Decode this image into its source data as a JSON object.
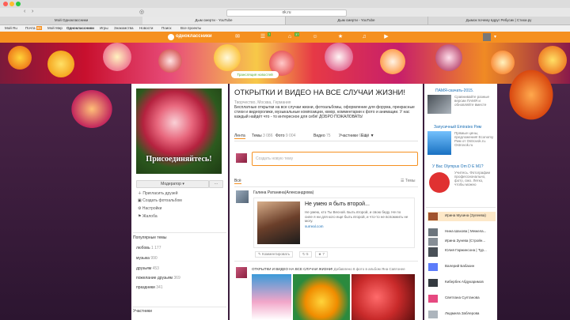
{
  "browser": {
    "window_title": "Дым смерти - YouTube",
    "url": "ok.ru",
    "tabs": [
      "Мой Одноклассники",
      "Дым смерти - YouTube",
      "Дым смерти - YouTube",
      "Дымок почему вдруг Ребусик | Стихи.ру"
    ],
    "bookmarks": [
      "Мой Ru",
      "Почта",
      "Мой Мир",
      "Одноклассники",
      "Игры",
      "Знакомства",
      "Новости",
      "Поиск",
      "Все проекты"
    ],
    "mail_badge": "99"
  },
  "ok_header": {
    "logo_text": "одноклассники",
    "icons": [
      "messages-icon",
      "discussions-icon",
      "notifications-icon",
      "guests-icon",
      "events-icon",
      "music-icon",
      "video-icon"
    ],
    "badges": [
      "7",
      "37",
      "",
      "",
      "",
      "",
      ""
    ]
  },
  "left": {
    "join_text": "Присоединяйтесь!",
    "moderator_label": "Модератор",
    "menu": [
      "Пригласить друзей",
      "Создать фотоальбом",
      "Настройки",
      "Жалоба"
    ],
    "popular_title": "Популярные темы",
    "topics": [
      {
        "name": "любовь",
        "count": "1 177"
      },
      {
        "name": "музыка",
        "count": "990"
      },
      {
        "name": "друзьям",
        "count": "453"
      },
      {
        "name": "пожелание друзьям",
        "count": "369"
      },
      {
        "name": "праздники",
        "count": "341"
      }
    ],
    "members_title": "Участники"
  },
  "center": {
    "badge_text": "Трансляция новостей",
    "title": "ОТКРЫТКИ И ВИДЕО НА ВСЕ СЛУЧАИ ЖИЗНИ!",
    "subtitle": "Творчество, Москва, Германия",
    "description": "Бесплатные открытки на все случаи жизни, фотоальбомы, оформление для форума, прекрасные стихи и видеоролики, музыкальные композиции, юмор, комментарии к фото и анимации. У нас каждый найдёт что - то интересное для себя! ДОБРО ПОЖАЛОВАТЬ!",
    "tabs": [
      {
        "label": "Лента",
        "count": ""
      },
      {
        "label": "Темы",
        "count": "3 086"
      },
      {
        "label": "Фото",
        "count": "9 004"
      },
      {
        "label": "Видео",
        "count": "75"
      },
      {
        "label": "Участники",
        "count": "67 8"
      },
      {
        "label": "Ещё ▼",
        "count": ""
      }
    ],
    "compose_placeholder": "Создать новую тему",
    "filter_all": "Всё",
    "filter_theme": "Темы",
    "post1": {
      "author": "Галина Ратанина(Александрова)",
      "headline": "Не умею я быть второй...",
      "excerpt": "Не умею, кто Ты Весной. Быть второй, и свою беду. Не по силе я ни для кого еще быть второй, и что-то не вспомнить не могу.",
      "source": "surreal.com",
      "comment_label": "Комментировать",
      "share_count": "5",
      "like_count": "7"
    },
    "post2": {
      "group": "ОТКРЫТКИ И ВИДЕО НА ВСЕ СЛУЧАИ ЖИЗНИ!",
      "note": "Добавлено 8 фото в альбом Яна Савтонее"
    }
  },
  "right": {
    "ads": [
      {
        "title": "ПАМЯ-скачать-2015.",
        "text": "Сравнивайте разные версии ПАМЯ и обновляйте вместе"
      },
      {
        "title": "Запусичный Emirates Рим",
        "text": "Прямые цены, предложения! Economy Рим от Ostrovok.ru. Ostrovok.ru"
      },
      {
        "title": "У Вас Olympus Om D E M1?",
        "text": "Учитесь. Фотографии профессионально, фото, смо. Легко, чтобы можно"
      }
    ],
    "members": [
      "Ирина Мухина (Зулеева)",
      "Нина Шахова | Межела...",
      "Ирина Зунева (Стройн...",
      "Юлия Гаржинсона | Тур...",
      "Валерий Бабахин",
      "Кибербек Абдукаримов",
      "Светлана Султанова",
      "Людмила Заблерова"
    ]
  },
  "colors": {
    "accent": "#f59020",
    "link": "#1a6fb5"
  }
}
